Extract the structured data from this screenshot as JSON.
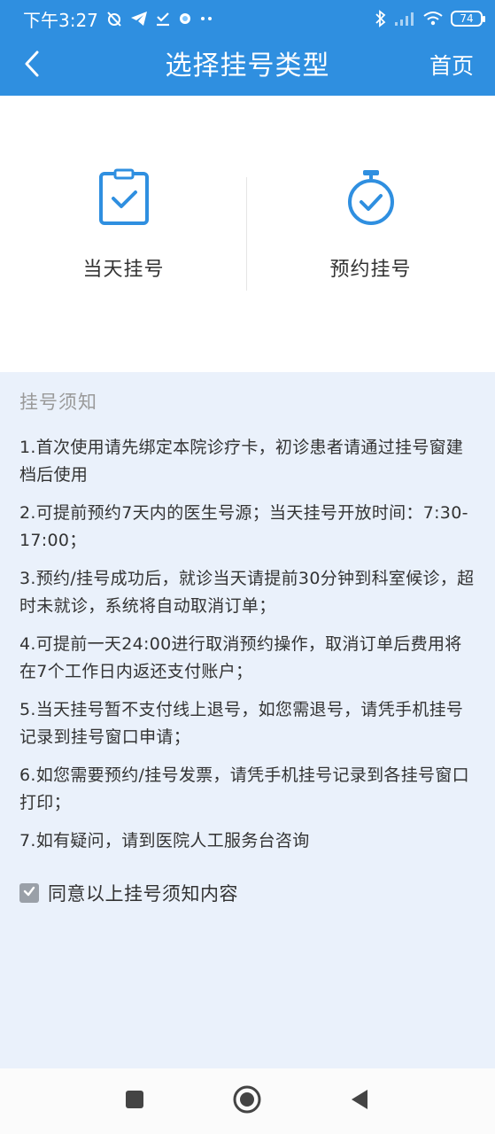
{
  "status_bar": {
    "time": "下午3:27",
    "battery": "74"
  },
  "header": {
    "title": "选择挂号类型",
    "home_label": "首页"
  },
  "options": [
    {
      "label": "当天挂号",
      "icon": "clipboard-check-icon"
    },
    {
      "label": "预约挂号",
      "icon": "stopwatch-check-icon"
    }
  ],
  "notice": {
    "title": "挂号须知",
    "items": [
      "1.首次使用请先绑定本院诊疗卡，初诊患者请通过挂号窗建档后使用",
      "2.可提前预约7天内的医生号源；当天挂号开放时间：7:30-17:00；",
      "3.预约/挂号成功后，就诊当天请提前30分钟到科室候诊，超时未就诊，系统将自动取消订单；",
      "4.可提前一天24:00进行取消预约操作，取消订单后费用将在7个工作日内返还支付账户；",
      "5.当天挂号暂不支付线上退号，如您需退号，请凭手机挂号记录到挂号窗口申请；",
      "6.如您需要预约/挂号发票，请凭手机挂号记录到各挂号窗口打印；",
      "7.如有疑问，请到医院人工服务台咨询"
    ],
    "agree_label": "同意以上挂号须知内容",
    "agree_checked": true
  },
  "colors": {
    "primary": "#2f8fe0",
    "notice_bg": "#eaf1fb"
  }
}
